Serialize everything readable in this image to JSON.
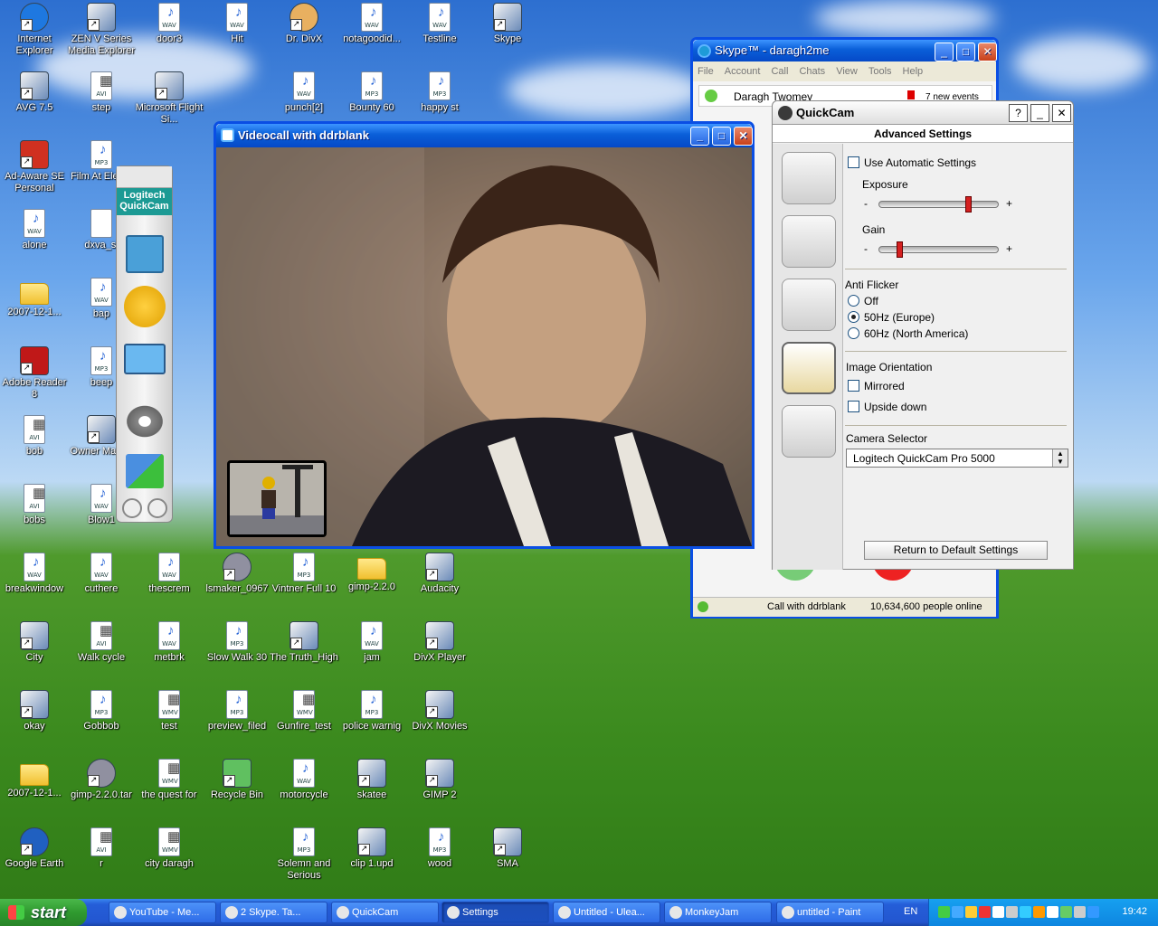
{
  "desktop": {
    "icons": [
      {
        "label": "Internet Explorer",
        "kind": "ie",
        "col": 0,
        "row": 0
      },
      {
        "label": "ZEN V Series Media Explorer",
        "kind": "app",
        "col": 1,
        "row": 0
      },
      {
        "label": "door3",
        "kind": "WAV",
        "col": 2,
        "row": 0
      },
      {
        "label": "Hit",
        "kind": "WAV",
        "col": 3,
        "row": 0
      },
      {
        "label": "Dr. DivX",
        "kind": "divx",
        "col": 4,
        "row": 0
      },
      {
        "label": "notagoodid...",
        "kind": "WAV",
        "col": 5,
        "row": 0
      },
      {
        "label": "Testline",
        "kind": "WAV",
        "col": 6,
        "row": 0
      },
      {
        "label": "Skype",
        "kind": "app",
        "col": 7,
        "row": 0
      },
      {
        "label": "AVG 7.5",
        "kind": "app",
        "col": 0,
        "row": 1
      },
      {
        "label": "step",
        "kind": "AVI",
        "col": 1,
        "row": 1
      },
      {
        "label": "Microsoft Flight Si...",
        "kind": "app",
        "col": 2,
        "row": 1
      },
      {
        "label": "punch[2]",
        "kind": "WAV",
        "col": 4,
        "row": 1
      },
      {
        "label": "Bounty 60",
        "kind": "MP3",
        "col": 5,
        "row": 1
      },
      {
        "label": "happy st",
        "kind": "MP3",
        "col": 6,
        "row": 1
      },
      {
        "label": "Ad-Aware SE Personal",
        "kind": "ad",
        "col": 0,
        "row": 2
      },
      {
        "label": "Film At Ele 30",
        "kind": "MP3",
        "col": 1,
        "row": 2
      },
      {
        "label": "alone",
        "kind": "WAV",
        "col": 0,
        "row": 3
      },
      {
        "label": "dxva_si",
        "kind": "txt",
        "col": 1,
        "row": 3
      },
      {
        "label": "2007-12-1...",
        "kind": "folder",
        "col": 0,
        "row": 4
      },
      {
        "label": "bap",
        "kind": "WAV",
        "col": 1,
        "row": 4
      },
      {
        "label": "Adobe Reader 8",
        "kind": "pdf",
        "col": 0,
        "row": 5
      },
      {
        "label": "beep",
        "kind": "MP3",
        "col": 1,
        "row": 5
      },
      {
        "label": "bob",
        "kind": "AVI",
        "col": 0,
        "row": 6
      },
      {
        "label": "Owner Manua",
        "kind": "app",
        "col": 1,
        "row": 6
      },
      {
        "label": "bobs",
        "kind": "AVI",
        "col": 0,
        "row": 7
      },
      {
        "label": "Blow1",
        "kind": "WAV",
        "col": 1,
        "row": 7
      },
      {
        "label": "breakwindow",
        "kind": "WAV",
        "col": 0,
        "row": 8
      },
      {
        "label": "cuthere",
        "kind": "WAV",
        "col": 1,
        "row": 8
      },
      {
        "label": "thescrem",
        "kind": "WAV",
        "col": 2,
        "row": 8
      },
      {
        "label": "lsmaker_0967",
        "kind": "zip",
        "col": 3,
        "row": 8
      },
      {
        "label": "Vintner Full 10",
        "kind": "MP3",
        "col": 4,
        "row": 8
      },
      {
        "label": "gimp-2.2.0",
        "kind": "folder",
        "col": 5,
        "row": 8
      },
      {
        "label": "Audacity",
        "kind": "app",
        "col": 6,
        "row": 8
      },
      {
        "label": "City",
        "kind": "app",
        "col": 0,
        "row": 9
      },
      {
        "label": "Walk cycle",
        "kind": "AVI",
        "col": 1,
        "row": 9
      },
      {
        "label": "metbrk",
        "kind": "WAV",
        "col": 2,
        "row": 9
      },
      {
        "label": "Slow Walk 30",
        "kind": "MP3",
        "col": 3,
        "row": 9
      },
      {
        "label": "The Truth_High",
        "kind": "app",
        "col": 4,
        "row": 9
      },
      {
        "label": "jam",
        "kind": "WAV",
        "col": 5,
        "row": 9
      },
      {
        "label": "DivX Player",
        "kind": "app",
        "col": 6,
        "row": 9
      },
      {
        "label": "okay",
        "kind": "app",
        "col": 0,
        "row": 10
      },
      {
        "label": "Gobbob",
        "kind": "MP3",
        "col": 1,
        "row": 10
      },
      {
        "label": "test",
        "kind": "WMV",
        "col": 2,
        "row": 10
      },
      {
        "label": "preview_filed",
        "kind": "MP3",
        "col": 3,
        "row": 10
      },
      {
        "label": "Gunfire_test",
        "kind": "WMV",
        "col": 4,
        "row": 10
      },
      {
        "label": "police warnig",
        "kind": "MP3",
        "col": 5,
        "row": 10
      },
      {
        "label": "DivX Movies",
        "kind": "app",
        "col": 6,
        "row": 10
      },
      {
        "label": "2007-12-1...",
        "kind": "folder",
        "col": 0,
        "row": 11
      },
      {
        "label": "gimp-2.2.0.tar",
        "kind": "zip",
        "col": 1,
        "row": 11
      },
      {
        "label": "the quest for",
        "kind": "WMV",
        "col": 2,
        "row": 11
      },
      {
        "label": "Recycle Bin",
        "kind": "bin",
        "col": 3,
        "row": 11
      },
      {
        "label": "motorcycle",
        "kind": "WAV",
        "col": 4,
        "row": 11
      },
      {
        "label": "skatee",
        "kind": "app",
        "col": 5,
        "row": 11
      },
      {
        "label": "GIMP 2",
        "kind": "app",
        "col": 6,
        "row": 11
      },
      {
        "label": "Google Earth",
        "kind": "earth",
        "col": 0,
        "row": 12
      },
      {
        "label": "r",
        "kind": "AVI",
        "col": 1,
        "row": 12
      },
      {
        "label": "city daragh",
        "kind": "WMV",
        "col": 2,
        "row": 12
      },
      {
        "label": "Solemn and Serious",
        "kind": "MP3",
        "col": 4,
        "row": 12
      },
      {
        "label": "clip 1.upd",
        "kind": "app",
        "col": 5,
        "row": 12
      },
      {
        "label": "wood",
        "kind": "MP3",
        "col": 6,
        "row": 12
      },
      {
        "label": "SMA",
        "kind": "app",
        "col": 7,
        "row": 12
      }
    ]
  },
  "skype": {
    "title": "Skype™ - daragh2me",
    "menu": [
      "File",
      "Account",
      "Call",
      "Chats",
      "View",
      "Tools",
      "Help"
    ],
    "contact": "Daragh Twomey",
    "events": "7 new events",
    "status_call": "Call with ddrblank",
    "online": "10,634,600 people online"
  },
  "videocall": {
    "title": "Videocall with ddrblank"
  },
  "logitech_bar": {
    "title": "Logitech QuickCam"
  },
  "quickcam": {
    "title": "QuickCam",
    "heading": "Advanced Settings",
    "auto": "Use Automatic Settings",
    "exposure": "Exposure",
    "exposure_level": 0.75,
    "gain": "Gain",
    "gain_level": 0.15,
    "antiflicker": "Anti Flicker",
    "af_options": [
      "Off",
      "50Hz (Europe)",
      "60Hz (North America)"
    ],
    "af_selected": "50Hz (Europe)",
    "orientation": "Image Orientation",
    "mirrored": "Mirrored",
    "upside": "Upside down",
    "camsel": "Camera Selector",
    "camera": "Logitech QuickCam Pro 5000",
    "reset": "Return to Default Settings"
  },
  "taskbar": {
    "start": "start",
    "items": [
      "YouTube - Me...",
      "2 Skype. Ta...",
      "QuickCam",
      "Settings",
      "Untitled - Ulea...",
      "MonkeyJam",
      "untitled - Paint"
    ],
    "active": "Settings",
    "lang": "EN",
    "clock": "19:42"
  }
}
